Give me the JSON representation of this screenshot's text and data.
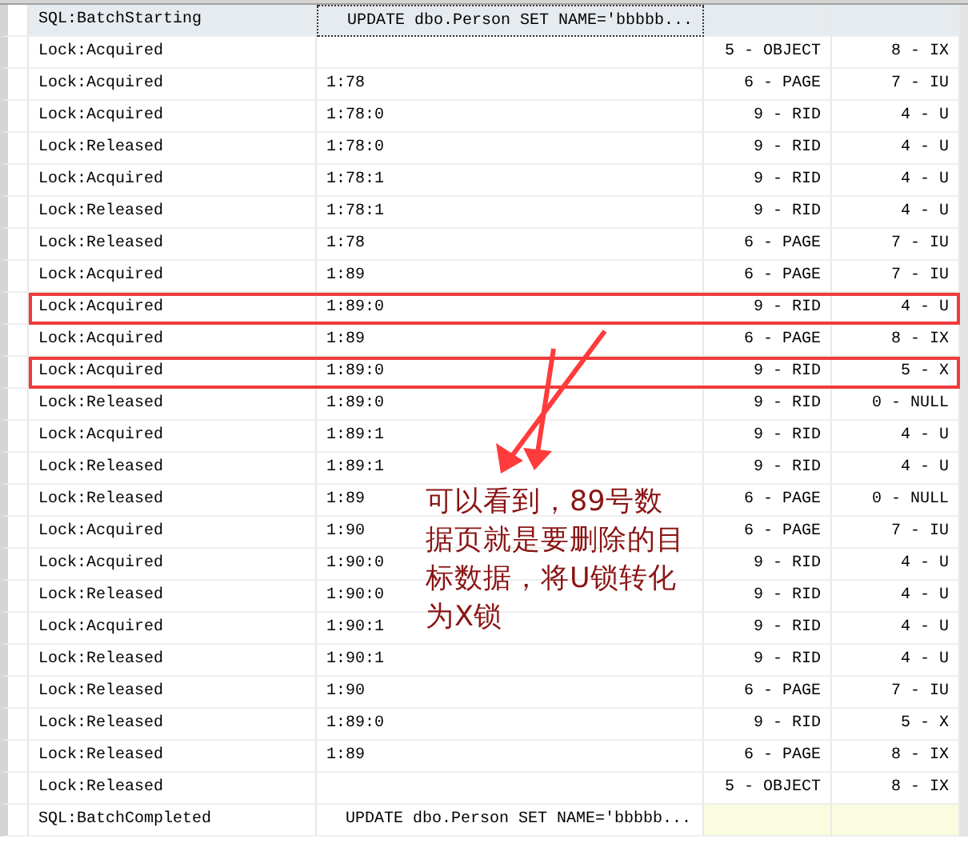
{
  "rows": [
    {
      "kind": "batch_start",
      "selected": true,
      "highlighted": false,
      "column_1": "SQL:BatchStarting",
      "column_2": "UPDATE dbo.Person SET NAME='bbbbb..."
    },
    {
      "kind": "lock",
      "selected": false,
      "highlighted": false,
      "column_1": "Lock:Acquired",
      "column_3": "5 - OBJECT",
      "column_4": "8 - IX"
    },
    {
      "kind": "lock",
      "selected": false,
      "highlighted": false,
      "column_1": "Lock:Acquired",
      "column_2": "1:78",
      "column_3": "6 - PAGE",
      "column_4": "7 - IU"
    },
    {
      "kind": "lock",
      "selected": false,
      "highlighted": false,
      "column_1": "Lock:Acquired",
      "column_2": "1:78:0",
      "column_3": "9 - RID",
      "column_4": "4 - U"
    },
    {
      "kind": "lock",
      "selected": false,
      "highlighted": false,
      "column_1": "Lock:Released",
      "column_2": "1:78:0",
      "column_3": "9 - RID",
      "column_4": "4 - U"
    },
    {
      "kind": "lock",
      "selected": false,
      "highlighted": false,
      "column_1": "Lock:Acquired",
      "column_2": "1:78:1",
      "column_3": "9 - RID",
      "column_4": "4 - U"
    },
    {
      "kind": "lock",
      "selected": false,
      "highlighted": false,
      "column_1": "Lock:Released",
      "column_2": "1:78:1",
      "column_3": "9 - RID",
      "column_4": "4 - U"
    },
    {
      "kind": "lock",
      "selected": false,
      "highlighted": false,
      "column_1": "Lock:Released",
      "column_2": "1:78",
      "column_3": "6 - PAGE",
      "column_4": "7 - IU"
    },
    {
      "kind": "lock",
      "selected": false,
      "highlighted": false,
      "column_1": "Lock:Acquired",
      "column_2": "1:89",
      "column_3": "6 - PAGE",
      "column_4": "7 - IU"
    },
    {
      "kind": "lock",
      "selected": false,
      "highlighted": true,
      "column_1": "Lock:Acquired",
      "column_2": "1:89:0",
      "column_3": "9 - RID",
      "column_4": "4 - U"
    },
    {
      "kind": "lock",
      "selected": false,
      "highlighted": false,
      "column_1": "Lock:Acquired",
      "column_2": "1:89",
      "column_3": "6 - PAGE",
      "column_4": "8 - IX"
    },
    {
      "kind": "lock",
      "selected": false,
      "highlighted": true,
      "column_1": "Lock:Acquired",
      "column_2": "1:89:0",
      "column_3": "9 - RID",
      "column_4": "5 - X"
    },
    {
      "kind": "lock",
      "selected": false,
      "highlighted": false,
      "column_1": "Lock:Released",
      "column_2": "1:89:0",
      "column_3": "9 - RID",
      "column_4": "0 - NULL"
    },
    {
      "kind": "lock",
      "selected": false,
      "highlighted": false,
      "column_1": "Lock:Acquired",
      "column_2": "1:89:1",
      "column_3": "9 - RID",
      "column_4": "4 - U"
    },
    {
      "kind": "lock",
      "selected": false,
      "highlighted": false,
      "column_1": "Lock:Released",
      "column_2": "1:89:1",
      "column_3": "9 - RID",
      "column_4": "4 - U"
    },
    {
      "kind": "lock",
      "selected": false,
      "highlighted": false,
      "column_1": "Lock:Released",
      "column_2": "1:89",
      "column_3": "6 - PAGE",
      "column_4": "0 - NULL"
    },
    {
      "kind": "lock",
      "selected": false,
      "highlighted": false,
      "column_1": "Lock:Acquired",
      "column_2": "1:90",
      "column_3": "6 - PAGE",
      "column_4": "7 - IU"
    },
    {
      "kind": "lock",
      "selected": false,
      "highlighted": false,
      "column_1": "Lock:Acquired",
      "column_2": "1:90:0",
      "column_3": "9 - RID",
      "column_4": "4 - U"
    },
    {
      "kind": "lock",
      "selected": false,
      "highlighted": false,
      "column_1": "Lock:Released",
      "column_2": "1:90:0",
      "column_3": "9 - RID",
      "column_4": "4 - U"
    },
    {
      "kind": "lock",
      "selected": false,
      "highlighted": false,
      "column_1": "Lock:Acquired",
      "column_2": "1:90:1",
      "column_3": "9 - RID",
      "column_4": "4 - U"
    },
    {
      "kind": "lock",
      "selected": false,
      "highlighted": false,
      "column_1": "Lock:Released",
      "column_2": "1:90:1",
      "column_3": "9 - RID",
      "column_4": "4 - U"
    },
    {
      "kind": "lock",
      "selected": false,
      "highlighted": false,
      "column_1": "Lock:Released",
      "column_2": "1:90",
      "column_3": "6 - PAGE",
      "column_4": "7 - IU"
    },
    {
      "kind": "lock",
      "selected": false,
      "highlighted": false,
      "column_1": "Lock:Released",
      "column_2": "1:89:0",
      "column_3": "9 - RID",
      "column_4": "5 - X"
    },
    {
      "kind": "lock",
      "selected": false,
      "highlighted": false,
      "column_1": "Lock:Released",
      "column_2": "1:89",
      "column_3": "6 - PAGE",
      "column_4": "8 - IX"
    },
    {
      "kind": "lock",
      "selected": false,
      "highlighted": false,
      "column_1": "Lock:Released",
      "column_3": "5 - OBJECT",
      "column_4": "8 - IX"
    },
    {
      "kind": "batch_end",
      "selected": false,
      "highlighted": false,
      "column_1": "SQL:BatchCompleted",
      "column_2": "UPDATE dbo.Person SET NAME='bbbbb..."
    }
  ],
  "annotation": {
    "text": "可以看到，89号数据页就是要删除的目标数据，将U锁转化为X锁"
  }
}
